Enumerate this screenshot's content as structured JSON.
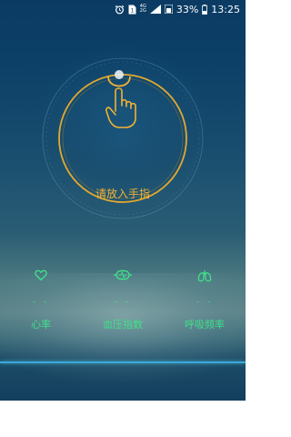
{
  "status_bar": {
    "alarm_icon": "alarm-clock-icon",
    "sim_icon": "sim-card-icon",
    "network_top": "4G",
    "network_bottom": "2G",
    "battery_percent": "33%",
    "time": "13:25"
  },
  "scanner": {
    "prompt": "请放入手指",
    "icon": "finger-touch-icon",
    "accent_color": "#f2b233"
  },
  "metrics": [
    {
      "icon": "heart-icon",
      "value": "- -",
      "label": "心率"
    },
    {
      "icon": "pulse-capsule-icon",
      "value": "- -",
      "label": "血压指数"
    },
    {
      "icon": "lungs-icon",
      "value": "- -",
      "label": "呼吸频率"
    }
  ],
  "colors": {
    "metric_green": "#3fe08a",
    "baseline_blue": "#3aa8d8"
  }
}
